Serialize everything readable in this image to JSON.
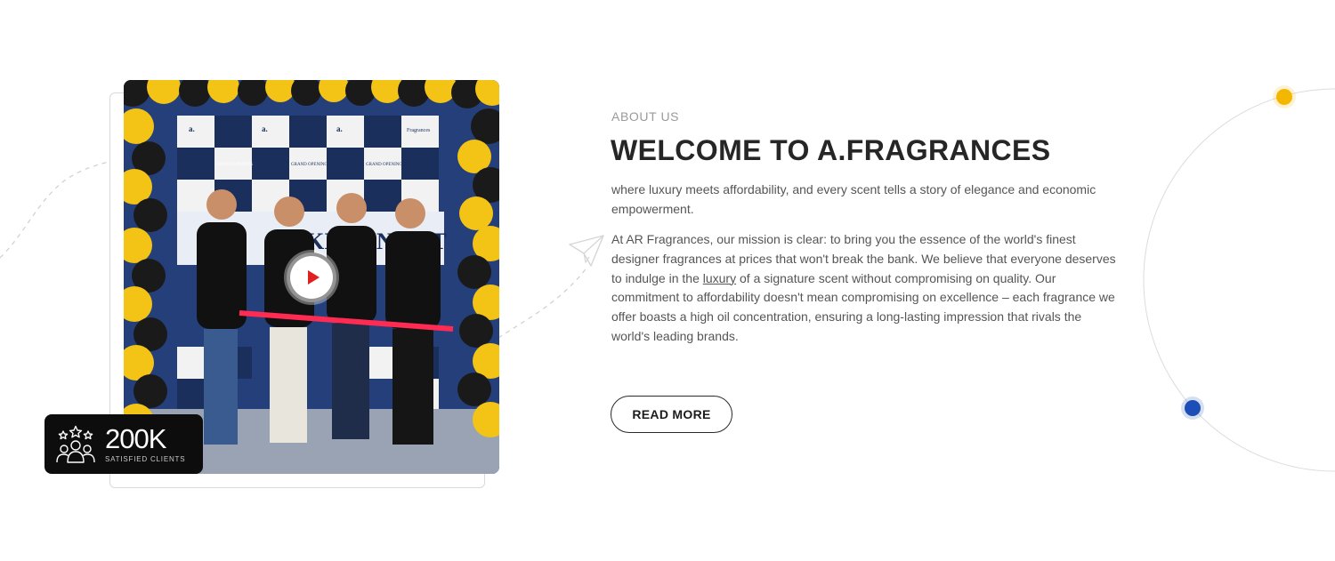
{
  "about": {
    "eyebrow": "ABOUT US",
    "title": "WELCOME TO A.FRAGRANCES",
    "intro": "where luxury meets affordability, and every scent tells a story of elegance and economic empowerment.",
    "body_part1": "At AR Fragrances, our mission is clear: to bring you the essence of the world's finest designer fragrances at prices that won't break the bank. We believe that everyone deserves to indulge in the ",
    "body_link": "luxury",
    "body_part2": " of a signature scent without compromising on quality. Our commitment to affordability doesn't mean compromising on excellence – each fragrance we offer boasts a high oil concentration, ensuring a long-lasting impression that rivals the world's leading brands.",
    "read_more_label": "READ MORE"
  },
  "media": {
    "play_icon": "play-icon",
    "backdrop_text": "GRAND OPENING",
    "backdrop_brand": "a.",
    "backdrop_brand_sub": "Fragrances",
    "banner_text": "KISTAN'S ST"
  },
  "stats": {
    "value": "200K",
    "label": "SATISFIED CLIENTS",
    "icon": "satisfied-clients-icon"
  },
  "colors": {
    "accent_yellow": "#f5b800",
    "accent_blue": "#1d4fb8",
    "heading": "#262626",
    "body_text": "#555555",
    "badge_bg": "#0d0d0d"
  }
}
